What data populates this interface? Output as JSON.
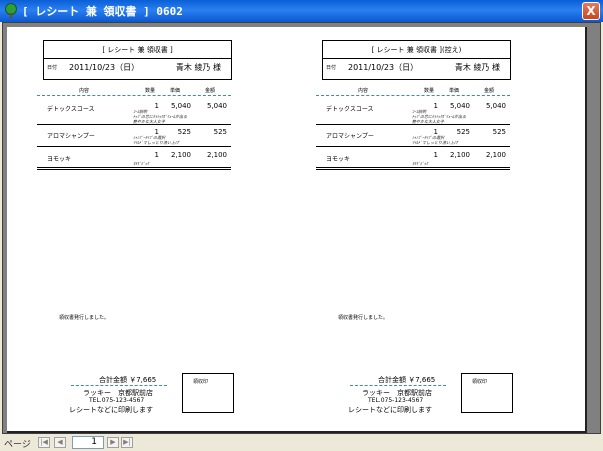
{
  "window": {
    "title": "[ レシート 兼 領収書 ] 0602",
    "close_label": "X"
  },
  "receipts": [
    {
      "title": "[ レシート 兼 領収書 ]",
      "date_label": "日付",
      "date": "2011/10/23（日）",
      "customer": "青木 綾乃 様",
      "columns": {
        "item": "内容",
        "qty": "数量",
        "unit": "単価",
        "amount": "金額"
      },
      "lines": [
        {
          "item": "デトックスコース",
          "qty": "1",
          "unit": "5,040",
          "amount": "5,040",
          "note": "ｺｰｽ説明\nﾄｯﾌﾟの芯にｾﾗﾐｯｸﾎﾞﾘｭｰﾑが出る\n艶やかな大人女子"
        },
        {
          "item": "アロマシャンプー",
          "qty": "1",
          "unit": "525",
          "amount": "525",
          "note": "ｼｬﾝﾌﾟｰﾀｲﾌﾟの選択\nﾏｲﾙﾄﾞでしっとり洗い上げ"
        },
        {
          "item": "ヨモッキ",
          "qty": "1",
          "unit": "2,100",
          "amount": "2,100",
          "note": "ﾖﾓｷﾞﾊﾟｯｸ"
        }
      ],
      "message": "領収書発行しました。",
      "total_label": "合計金額 ￥7,665",
      "shop_name": "ラッキー　京都駅前店",
      "shop_tel": "TEL.075-123-4567",
      "shop_note": "レシートなどに印刷します",
      "stamp_label": "領収印"
    },
    {
      "title": "[ レシート 兼 領収書 ](控え)",
      "date_label": "日付",
      "date": "2011/10/23（日）",
      "customer": "青木 綾乃 様",
      "columns": {
        "item": "内容",
        "qty": "数量",
        "unit": "単価",
        "amount": "金額"
      },
      "lines": [
        {
          "item": "デトックスコース",
          "qty": "1",
          "unit": "5,040",
          "amount": "5,040",
          "note": "ｺｰｽ説明\nﾄｯﾌﾟの芯にｾﾗﾐｯｸﾎﾞﾘｭｰﾑが出る\n艶やかな大人女子"
        },
        {
          "item": "アロマシャンプー",
          "qty": "1",
          "unit": "525",
          "amount": "525",
          "note": "ｼｬﾝﾌﾟｰﾀｲﾌﾟの選択\nﾏｲﾙﾄﾞでしっとり洗い上げ"
        },
        {
          "item": "ヨモッキ",
          "qty": "1",
          "unit": "2,100",
          "amount": "2,100",
          "note": "ﾖﾓｷﾞﾊﾟｯｸ"
        }
      ],
      "message": "領収書発行しました。",
      "total_label": "合計金額 ￥7,665",
      "shop_name": "ラッキー　京都駅前店",
      "shop_tel": "TEL.075-123-4567",
      "shop_note": "レシートなどに印刷します",
      "stamp_label": "領収印"
    }
  ],
  "navigation": {
    "page_label": "ページ",
    "current_page": "1",
    "first_icon": "first-page-icon",
    "prev_icon": "prev-page-icon",
    "next_icon": "next-page-icon",
    "last_icon": "last-page-icon"
  },
  "colors": {
    "titlebar": "#0a5fd8",
    "dotted_rule": "#3a8fa0"
  }
}
